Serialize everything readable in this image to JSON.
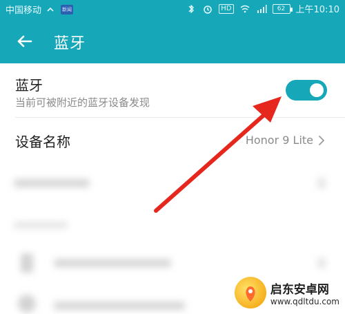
{
  "statusbar": {
    "carrier": "中国移动",
    "badge": "新闻",
    "hd": "HD",
    "battery": "62",
    "time": "上午10:10"
  },
  "header": {
    "title": "蓝牙"
  },
  "bluetooth": {
    "title": "蓝牙",
    "subtitle": "当前可被附近的蓝牙设备发现",
    "enabled": true
  },
  "device_name": {
    "label": "设备名称",
    "value": "Honor 9 Lite"
  },
  "watermark": {
    "title": "启东安卓网",
    "url": "www.qdltdu.com"
  },
  "colors": {
    "accent": "#16a7b9",
    "arrow": "#e5271e"
  }
}
